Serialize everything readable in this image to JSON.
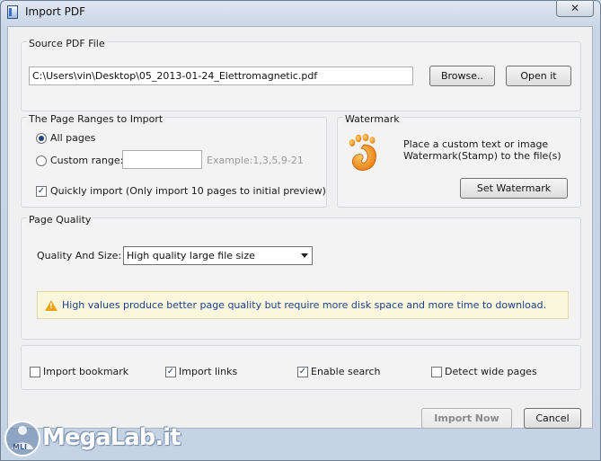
{
  "window": {
    "title": "Import PDF",
    "close_glyph": "✕"
  },
  "source": {
    "group_label": "Source PDF File",
    "path_value": "C:\\Users\\vin\\Desktop\\05_2013-01-24_Elettromagnetic.pdf",
    "browse_label": "Browse..",
    "open_label": "Open it"
  },
  "ranges": {
    "group_label": "The Page Ranges to Import",
    "all_pages_label": "All pages",
    "all_pages_selected": true,
    "custom_range_label": "Custom range:",
    "custom_range_value": "",
    "custom_range_example": "Example:1,3,5,9-21",
    "quick_import_label": "Quickly import (Only import 10 pages to  initial  preview)",
    "quick_import_checked": true
  },
  "watermark": {
    "group_label": "Watermark",
    "icon": "foot-icon",
    "description_line1": "Place a custom text or image",
    "description_line2": "Watermark(Stamp) to the file(s)",
    "set_label": "Set Watermark"
  },
  "quality": {
    "group_label": "Page Quality",
    "field_label": "Quality And Size:",
    "selected_value": "High quality large file size",
    "warning_text": "High values produce better page quality but require more disk space and more time to download."
  },
  "options": {
    "bookmark_label": "Import bookmark",
    "bookmark_checked": false,
    "links_label": "Import links",
    "links_checked": true,
    "search_label": "Enable search",
    "search_checked": true,
    "wide_label": "Detect wide pages",
    "wide_checked": false
  },
  "actions": {
    "import_now_label": "Import Now",
    "cancel_label": "Cancel"
  },
  "overlay_logo": {
    "text": "MegaLab.it",
    "badge": "MLI"
  },
  "colors": {
    "warning_text": "#1b3f8f",
    "warning_bg": "#fbf7dd",
    "icon_orange": "#f08a12"
  }
}
